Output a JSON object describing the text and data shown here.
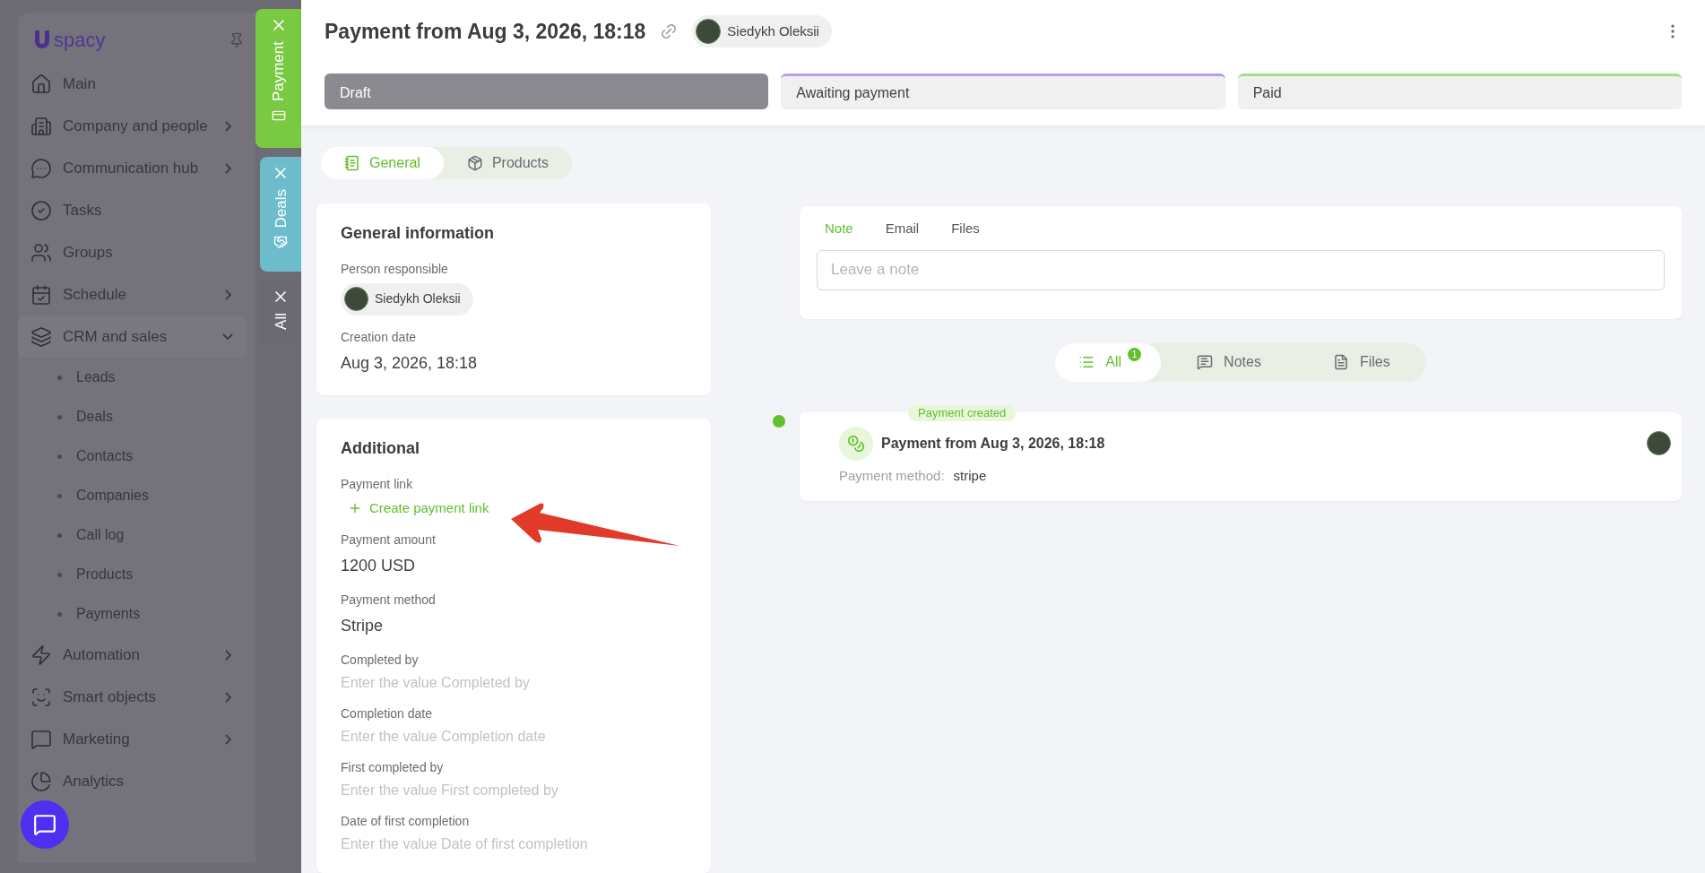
{
  "sidebar": {
    "logo": "spacy",
    "items": [
      {
        "label": "Main",
        "submenu": false
      },
      {
        "label": "Company and people",
        "submenu": true,
        "expanded": false
      },
      {
        "label": "Communication hub",
        "submenu": true,
        "expanded": false
      },
      {
        "label": "Tasks",
        "submenu": false
      },
      {
        "label": "Groups",
        "submenu": false
      },
      {
        "label": "Schedule",
        "submenu": true,
        "expanded": false
      },
      {
        "label": "CRM and sales",
        "submenu": true,
        "expanded": true,
        "children": [
          {
            "label": "Leads"
          },
          {
            "label": "Deals"
          },
          {
            "label": "Contacts"
          },
          {
            "label": "Companies"
          },
          {
            "label": "Call log"
          },
          {
            "label": "Products"
          },
          {
            "label": "Payments"
          }
        ]
      },
      {
        "label": "Automation",
        "submenu": true,
        "expanded": false
      },
      {
        "label": "Smart objects",
        "submenu": true,
        "expanded": false
      },
      {
        "label": "Marketing",
        "submenu": true,
        "expanded": false
      },
      {
        "label": "Analytics",
        "submenu": false
      }
    ]
  },
  "side_tabs": [
    {
      "label": "Payment",
      "color": "#7ac943"
    },
    {
      "label": "Deals",
      "color": "#6cbccb"
    },
    {
      "label": "All",
      "color": "#6b6a72"
    }
  ],
  "header": {
    "title": "Payment from Aug 3, 2026, 18:18",
    "person": "Siedykh Oleksii"
  },
  "stages": [
    {
      "label": "Draft",
      "selected": true,
      "color": "#8a8a90"
    },
    {
      "label": "Awaiting payment",
      "selected": false,
      "color": "#b79cf5"
    },
    {
      "label": "Paid",
      "selected": false,
      "color": "#a8db8a"
    }
  ],
  "view_tabs": [
    {
      "label": "General",
      "selected": true
    },
    {
      "label": "Products",
      "selected": false
    }
  ],
  "cards": [
    {
      "title": "General information",
      "fields": [
        {
          "label": "Person responsible",
          "kind": "person",
          "value": "Siedykh Oleksii"
        },
        {
          "label": "Creation date",
          "kind": "text",
          "value": "Aug 3, 2026, 18:18"
        }
      ]
    },
    {
      "title": "Additional",
      "fields": [
        {
          "label": "Payment link",
          "kind": "action",
          "value": "Create payment link"
        },
        {
          "label": "Payment amount",
          "kind": "text",
          "value": "1200 USD"
        },
        {
          "label": "Payment method",
          "kind": "text",
          "value": "Stripe"
        },
        {
          "label": "Completed by",
          "kind": "input",
          "placeholder": "Enter the value Completed by"
        },
        {
          "label": "Completion date",
          "kind": "input",
          "placeholder": "Enter the value Completion date"
        },
        {
          "label": "First completed by",
          "kind": "input",
          "placeholder": "Enter the value First completed by"
        },
        {
          "label": "Date of first completion",
          "kind": "input",
          "placeholder": "Enter the value Date of first completion"
        }
      ]
    }
  ],
  "composer": {
    "tabs": [
      {
        "label": "Note",
        "selected": true
      },
      {
        "label": "Email",
        "selected": false
      },
      {
        "label": "Files",
        "selected": false
      }
    ],
    "placeholder": "Leave a note"
  },
  "filters": [
    {
      "label": "All",
      "selected": true,
      "count": "1"
    },
    {
      "label": "Notes",
      "selected": false
    },
    {
      "label": "Files",
      "selected": false
    }
  ],
  "timeline": [
    {
      "badge": "Payment created",
      "title": "Payment from Aug 3, 2026, 18:18",
      "detail_label": "Payment method:",
      "detail_value": "stripe"
    }
  ]
}
